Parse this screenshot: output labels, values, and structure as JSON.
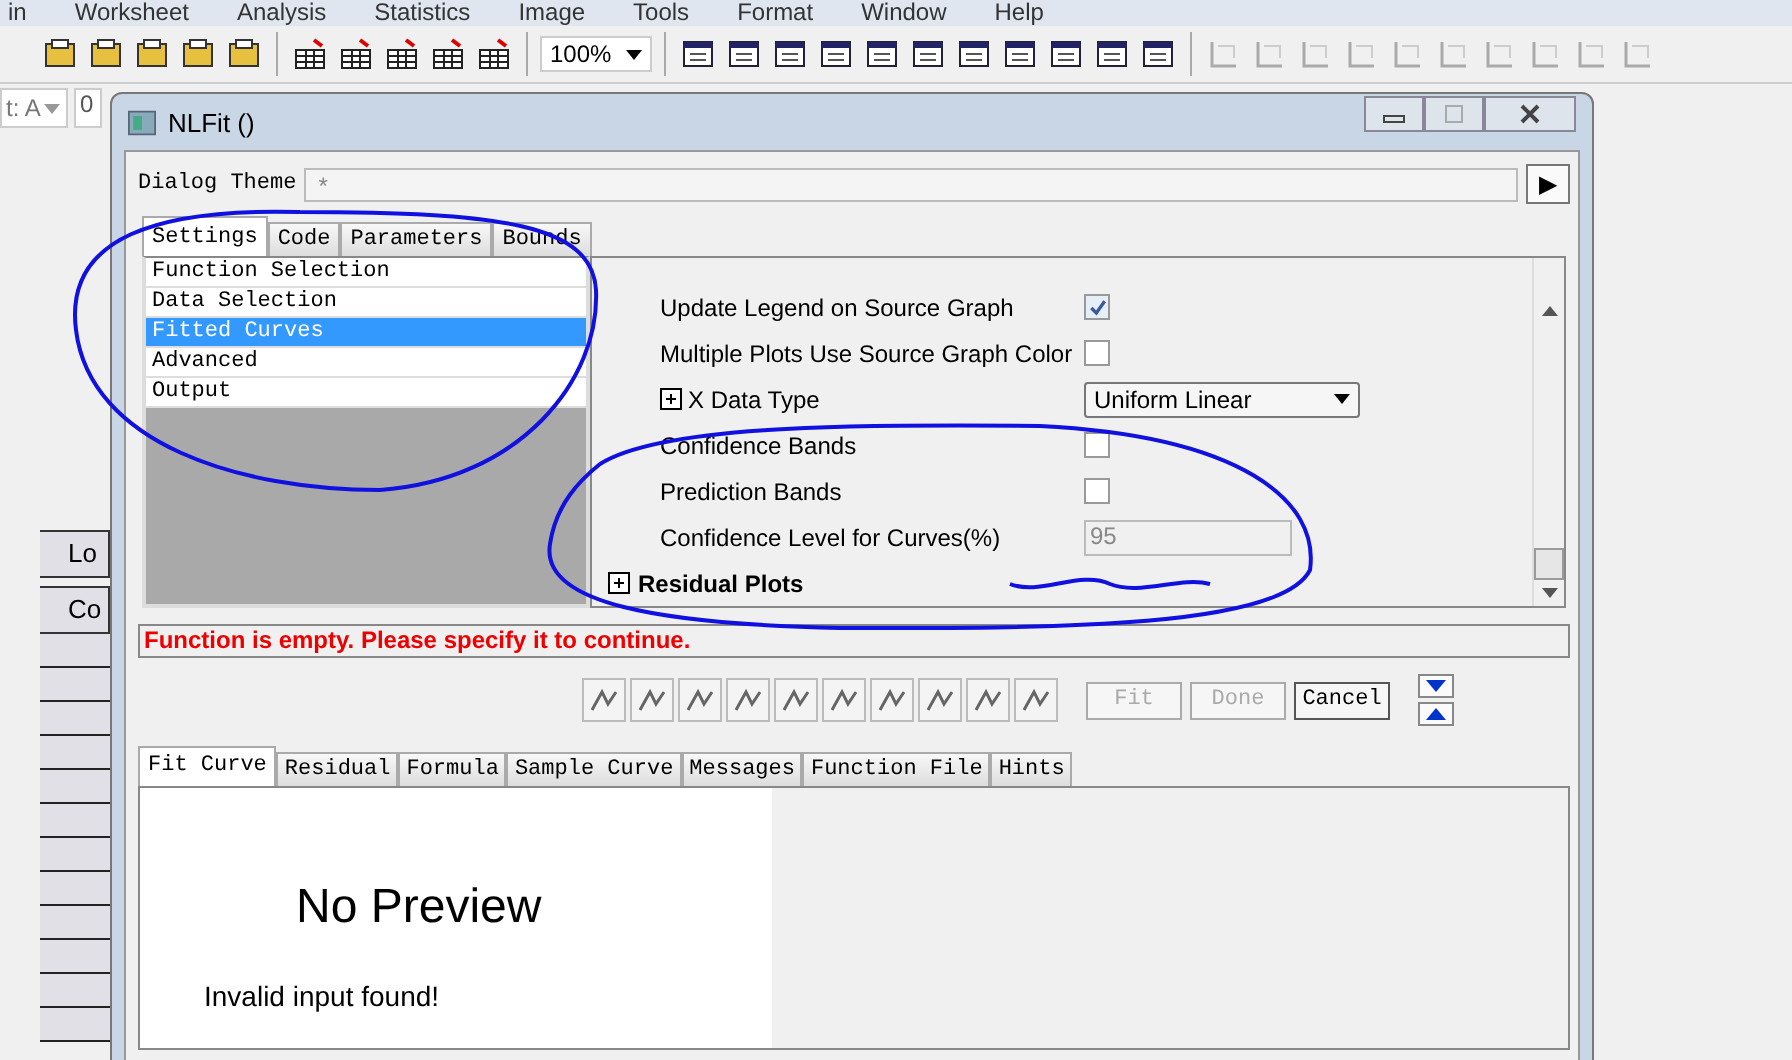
{
  "menu": [
    {
      "label": "in"
    },
    {
      "label": "Worksheet"
    },
    {
      "label": "Analysis"
    },
    {
      "label": "Statistics"
    },
    {
      "label": "Image"
    },
    {
      "label": "Tools"
    },
    {
      "label": "Format"
    },
    {
      "label": "Window"
    },
    {
      "label": "Help"
    }
  ],
  "toolbar": {
    "zoom": "100%"
  },
  "row2": {
    "combo": "t: A",
    "field": "0"
  },
  "sheet": {
    "cells": [
      "Lo",
      "Co"
    ]
  },
  "dialog": {
    "title": "NLFit ()",
    "theme_label": "Dialog Theme",
    "theme_value": "*",
    "theme_button": "▶",
    "tabs": [
      {
        "label": "Settings",
        "selected": true
      },
      {
        "label": "Code",
        "selected": false
      },
      {
        "label": "Parameters",
        "selected": false
      },
      {
        "label": "Bounds",
        "selected": false
      }
    ],
    "pages": [
      {
        "label": "Function Selection",
        "selected": false
      },
      {
        "label": "Data Selection",
        "selected": false
      },
      {
        "label": "Fitted Curves",
        "selected": true
      },
      {
        "label": "Advanced",
        "selected": false
      },
      {
        "label": "Output",
        "selected": false
      }
    ],
    "rows": [
      {
        "kind": "checkbox",
        "label": "Update Legend on Source Graph",
        "checked": true
      },
      {
        "kind": "checkbox",
        "label": "Multiple Plots Use Source Graph Color",
        "checked": false
      },
      {
        "kind": "dropdown",
        "label": "X Data Type",
        "value": "Uniform Linear"
      },
      {
        "kind": "checkbox",
        "label": "Confidence Bands",
        "checked": false
      },
      {
        "kind": "checkbox",
        "label": "Prediction Bands",
        "checked": false
      },
      {
        "kind": "field",
        "label": "Confidence Level for Curves(%)",
        "value": "95",
        "disabled": true
      },
      {
        "kind": "group",
        "label": "Residual Plots"
      }
    ],
    "message": "Function is empty. Please specify it to continue.",
    "buttons": [
      {
        "label": "Fit",
        "disabled": true
      },
      {
        "label": "Done",
        "disabled": true
      },
      {
        "label": "Cancel",
        "disabled": false
      }
    ],
    "preview_tabs": [
      {
        "label": "Fit Curve",
        "selected": true
      },
      {
        "label": "Residual",
        "selected": false
      },
      {
        "label": "Formula",
        "selected": false
      },
      {
        "label": "Sample Curve",
        "selected": false
      },
      {
        "label": "Messages",
        "selected": false
      },
      {
        "label": "Function File",
        "selected": false
      },
      {
        "label": "Hints",
        "selected": false
      }
    ],
    "preview": {
      "title": "No Preview",
      "message": "Invalid input found!"
    }
  }
}
